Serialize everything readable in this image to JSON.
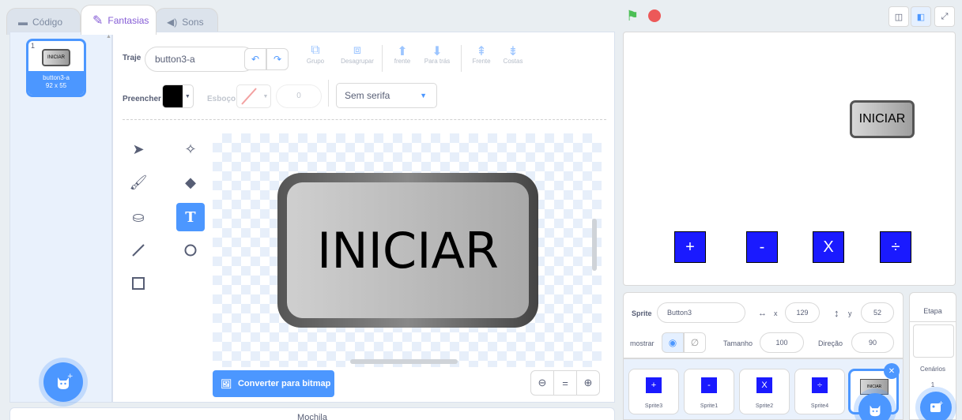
{
  "tabs": {
    "codigo": "Código",
    "fantasias": "Fantasias",
    "sons": "Sons"
  },
  "costume_list": {
    "items": [
      {
        "number": "1",
        "thumb_text": "INICIAR",
        "name": "button3-a",
        "size": "92 x 55"
      }
    ]
  },
  "paint_editor": {
    "costume_label": "Traje",
    "costume_name": "button3-a",
    "group_label": "Grupo",
    "ungroup_label": "Desagrupar",
    "forward_label": "frente",
    "backward_label": "Para trás",
    "front_label": "Frente",
    "back_label": "Costas",
    "fill_label": "Preencher",
    "fill_color": "#000000",
    "outline_label": "Esboço",
    "outline_width": "0",
    "font": "Sem serifa",
    "canvas_text": "INICIAR",
    "convert_label": "Converter para bitmap",
    "zoom_out": "−",
    "zoom_reset": "=",
    "zoom_in": "+"
  },
  "backpack_label": "Mochila",
  "stage": {
    "iniciar_text": "INICIAR",
    "buttons": [
      "+",
      "-",
      "X",
      "÷"
    ]
  },
  "sprite_info": {
    "sprite_label": "Sprite",
    "sprite_name": "Button3",
    "x_label": "x",
    "x_value": "129",
    "y_label": "y",
    "y_value": "52",
    "show_label": "mostrar",
    "size_label": "Tamanho",
    "size_value": "100",
    "direction_label": "Direção",
    "direction_value": "90"
  },
  "sprites": [
    {
      "name": "Sprite3",
      "symbol": "+"
    },
    {
      "name": "Sprite1",
      "symbol": "-"
    },
    {
      "name": "Sprite2",
      "symbol": "X"
    },
    {
      "name": "Sprite4",
      "symbol": "÷"
    },
    {
      "name": "",
      "symbol": "INICIAR"
    }
  ],
  "stage_selector": {
    "title": "Etapa",
    "backdrops_label": "Cenários",
    "backdrops_count": "1"
  },
  "colors": {
    "accent": "#4c97ff",
    "fantasias_tab": "#855cd6",
    "flag": "#4cbf56",
    "stop": "#ec5959",
    "operator_button": "#1a1aff"
  }
}
